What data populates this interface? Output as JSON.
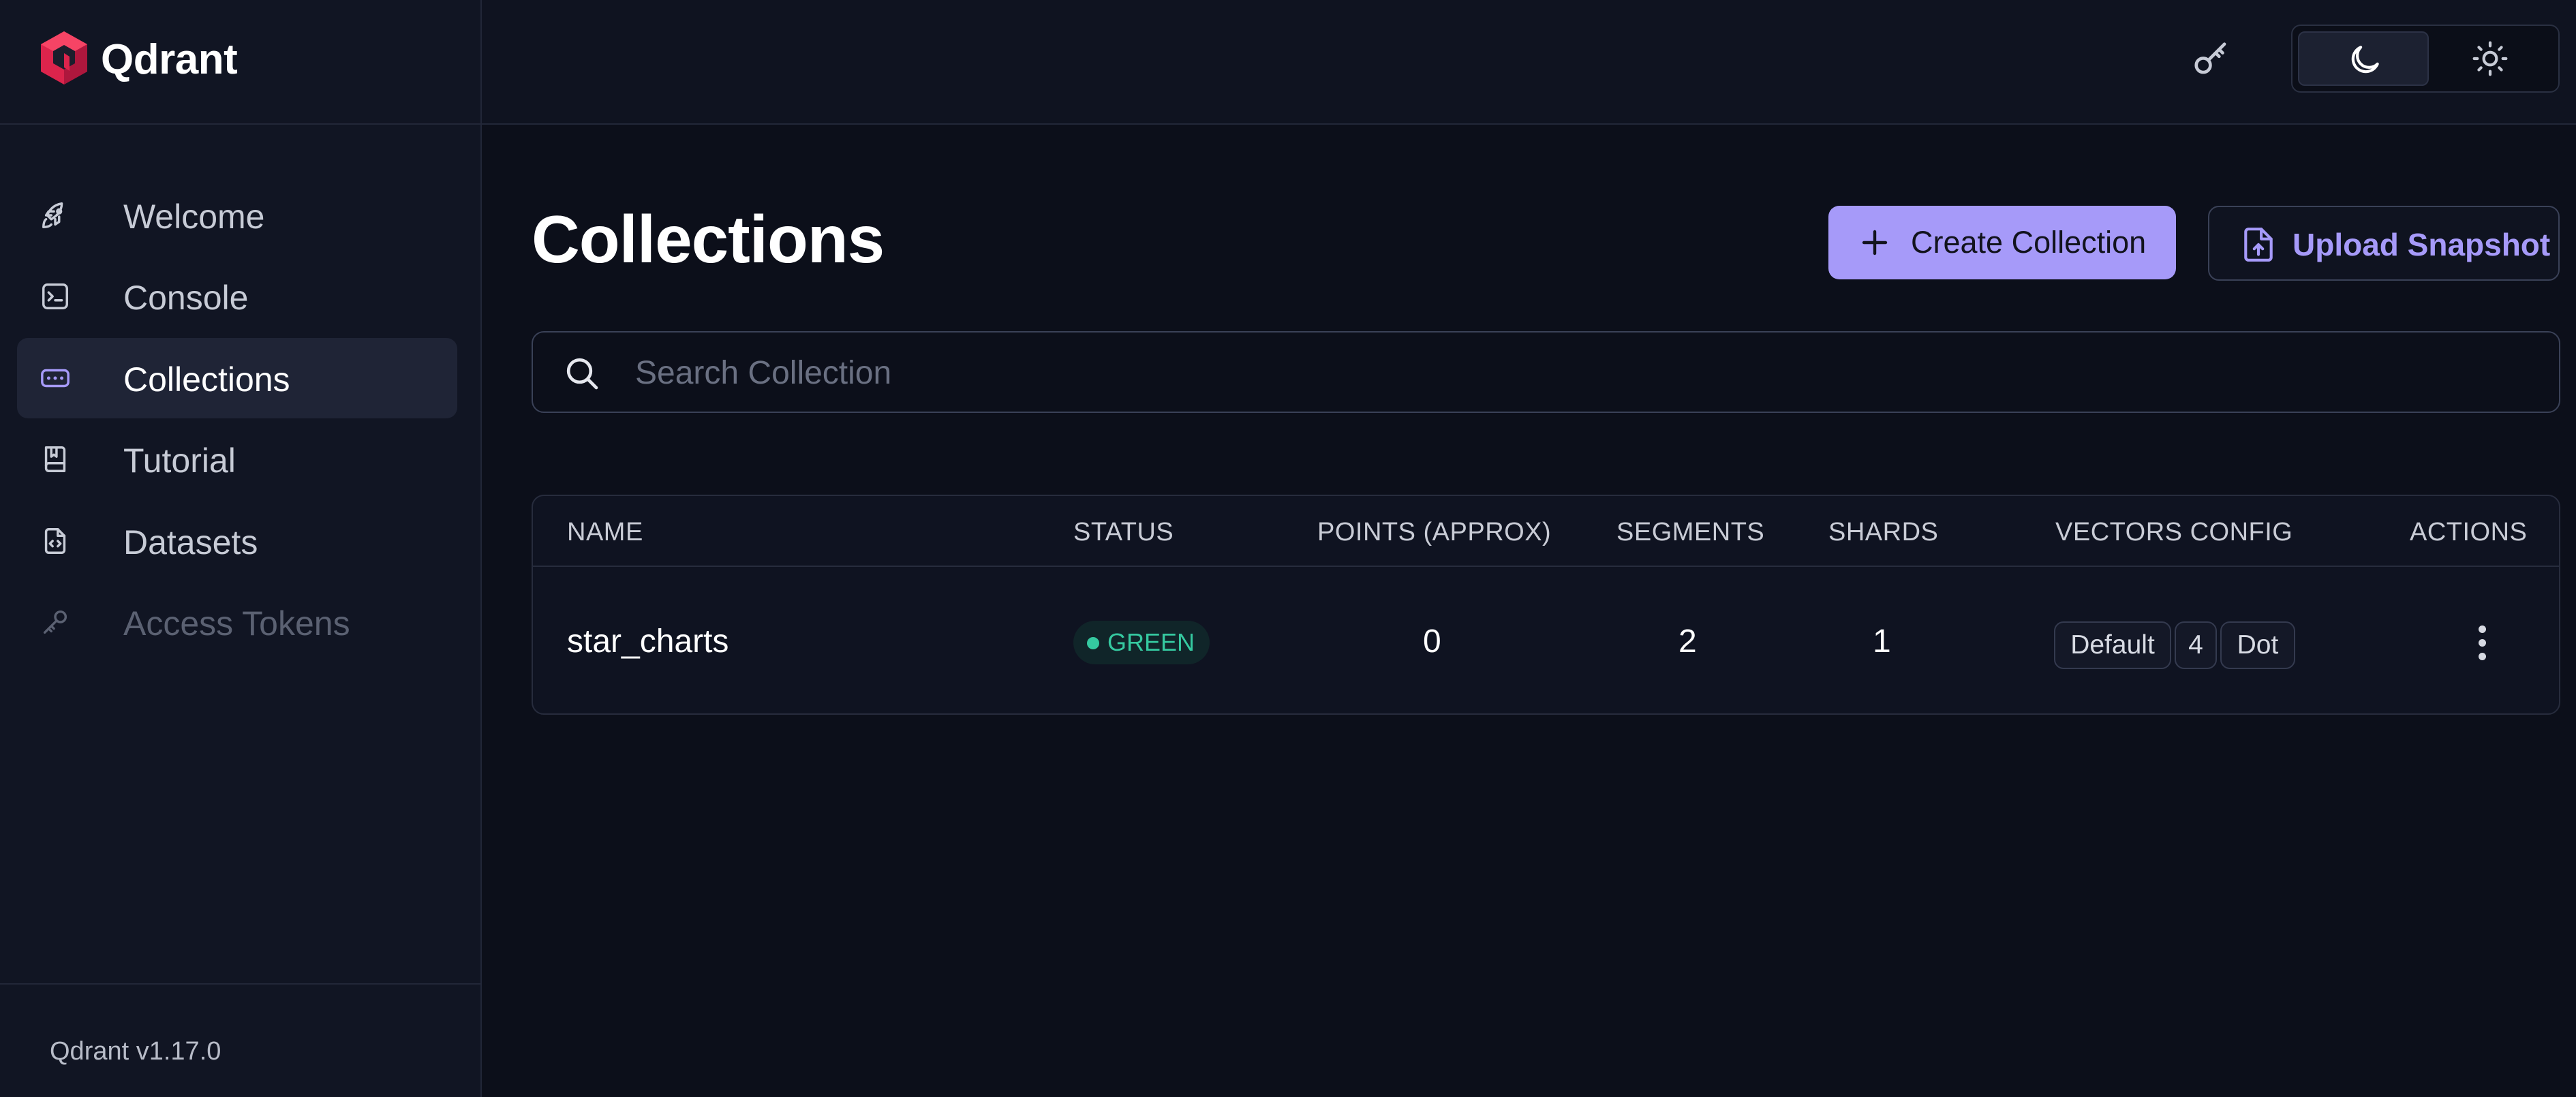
{
  "brand": {
    "name": "Qdrant",
    "accent": "#dc244c"
  },
  "sidebar": {
    "items": [
      {
        "label": "Welcome",
        "icon": "rocket-icon",
        "active": false,
        "disabled": false
      },
      {
        "label": "Console",
        "icon": "terminal-icon",
        "active": false,
        "disabled": false
      },
      {
        "label": "Collections",
        "icon": "collections-icon",
        "active": true,
        "disabled": false
      },
      {
        "label": "Tutorial",
        "icon": "book-icon",
        "active": false,
        "disabled": false
      },
      {
        "label": "Datasets",
        "icon": "file-code-icon",
        "active": false,
        "disabled": false
      },
      {
        "label": "Access Tokens",
        "icon": "key-icon",
        "active": false,
        "disabled": true
      }
    ],
    "version": "Qdrant v1.17.0"
  },
  "header": {
    "api_key_icon": "key-icon",
    "theme": {
      "selected": "dark",
      "options": [
        "moon-icon",
        "sun-icon"
      ]
    }
  },
  "main": {
    "title": "Collections",
    "create_button": "Create Collection",
    "upload_button": "Upload Snapshot",
    "search": {
      "placeholder": "Search Collection",
      "value": ""
    },
    "table": {
      "columns": [
        "NAME",
        "STATUS",
        "POINTS (APPROX)",
        "SEGMENTS",
        "SHARDS",
        "VECTORS CONFIG",
        "ACTIONS"
      ],
      "rows": [
        {
          "name": "star_charts",
          "status": "GREEN",
          "points": "0",
          "segments": "2",
          "shards": "1",
          "vectors": {
            "name": "Default",
            "size": "4",
            "distance": "Dot"
          }
        }
      ]
    }
  },
  "colors": {
    "background": "#0c0f1a",
    "sidebar": "#111523",
    "primary_button": "#a69af9",
    "status_green": "#35c9a0"
  }
}
